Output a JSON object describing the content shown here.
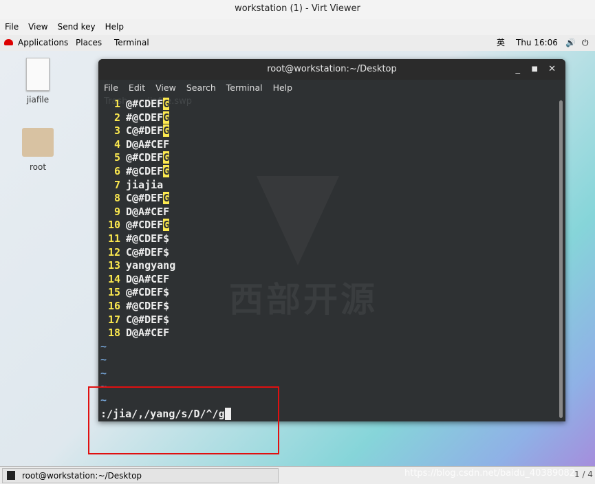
{
  "window_title": "workstation (1) - Virt Viewer",
  "menu": [
    "File",
    "View",
    "Send key",
    "Help"
  ],
  "gnome": {
    "applications": "Applications",
    "places": "Places",
    "terminal": "Terminal",
    "ime": "英",
    "clock": "Thu 16:06"
  },
  "desktop_icons": [
    {
      "label": "jiafile",
      "icon": "text-file-icon"
    },
    {
      "label": "root",
      "icon": "home-folder-icon"
    }
  ],
  "terminal": {
    "title": "root@workstation:~/Desktop",
    "menu": [
      "File",
      "Edit",
      "View",
      "Search",
      "Terminal",
      "Help"
    ],
    "background_text": "Trash      .jiafile.swp",
    "watermark": "西部开源",
    "lines": [
      {
        "n": "1",
        "text": "@#CDEF",
        "hl": "G"
      },
      {
        "n": "2",
        "text": "#@CDEF",
        "hl": "G"
      },
      {
        "n": "3",
        "text": "C@#DEF",
        "hl": "G"
      },
      {
        "n": "4",
        "text": "D@A#CEF",
        "hl": ""
      },
      {
        "n": "5",
        "text": "@#CDEF",
        "hl": "G"
      },
      {
        "n": "6",
        "text": "#@CDEF",
        "hl": "G"
      },
      {
        "n": "7",
        "text": "jiajia",
        "hl": ""
      },
      {
        "n": "8",
        "text": "C@#DEF",
        "hl": "G"
      },
      {
        "n": "9",
        "text": "D@A#CEF",
        "hl": ""
      },
      {
        "n": "10",
        "text": "@#CDEF",
        "hl": "G"
      },
      {
        "n": "11",
        "text": "#@CDEF$",
        "hl": ""
      },
      {
        "n": "12",
        "text": "C@#DEF$",
        "hl": ""
      },
      {
        "n": "13",
        "text": "yangyang",
        "hl": ""
      },
      {
        "n": "14",
        "text": "D@A#CEF",
        "hl": ""
      },
      {
        "n": "15",
        "text": "@#CDEF$",
        "hl": ""
      },
      {
        "n": "16",
        "text": "#@CDEF$",
        "hl": ""
      },
      {
        "n": "17",
        "text": "C@#DEF$",
        "hl": ""
      },
      {
        "n": "18",
        "text": "D@A#CEF",
        "hl": ""
      }
    ],
    "tilde": "~",
    "command": ":/jia/,/yang/s/D/^/g"
  },
  "taskbar": {
    "item": "root@workstation:~/Desktop",
    "watermark": "https://blog.csdn.net/baidu_40389082",
    "workspace": "1 / 4"
  },
  "colors": {
    "highlight": "#fce94f",
    "annotation_box": "#e01010"
  }
}
